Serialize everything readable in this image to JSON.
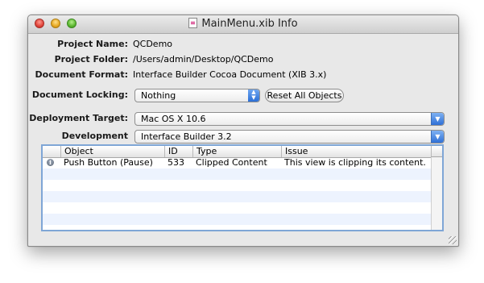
{
  "window": {
    "title": "MainMenu.xib Info"
  },
  "info": {
    "project_name_label": "Project Name:",
    "project_name": "QCDemo",
    "project_folder_label": "Project Folder:",
    "project_folder": "/Users/admin/Desktop/QCDemo",
    "document_format_label": "Document Format:",
    "document_format": "Interface Builder Cocoa Document (XIB 3.x)"
  },
  "locking": {
    "label": "Document Locking:",
    "value": "Nothing",
    "reset_button": "Reset All Objects"
  },
  "deployment": {
    "label": "Deployment Target:",
    "value": "Mac OS X 10.6"
  },
  "development": {
    "label": "Development Target:",
    "value": "Interface Builder 3.2"
  },
  "table": {
    "columns": [
      "Object",
      "ID",
      "Type",
      "Issue"
    ],
    "rows": [
      {
        "object": "Push Button (Pause)",
        "id": "533",
        "type": "Clipped Content",
        "issue": "This view is clipping its content.",
        "icon": "info-icon"
      }
    ]
  },
  "colors": {
    "accent": "#2f70d6",
    "table_border": "#7fa6d6",
    "stripe": "#edf3fe"
  }
}
